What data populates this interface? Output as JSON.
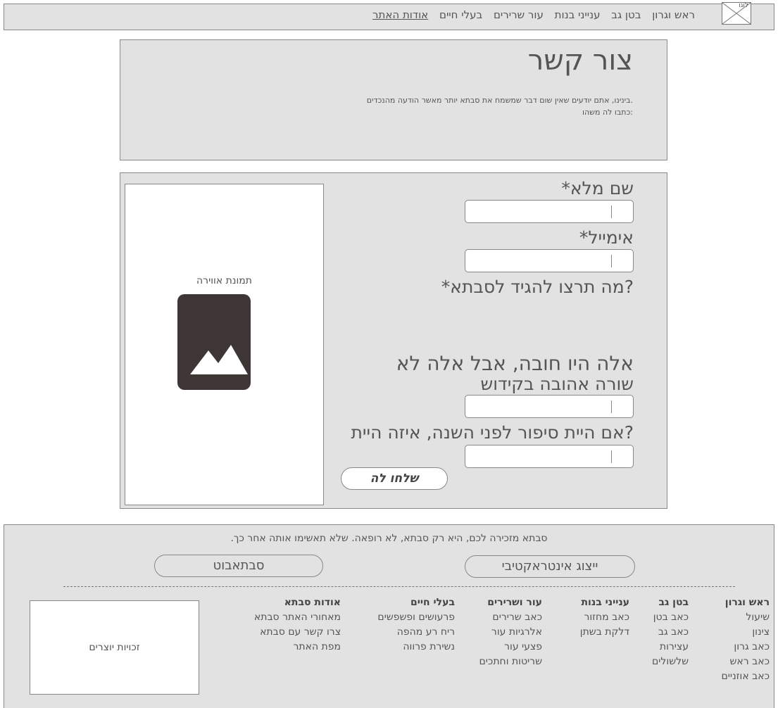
{
  "logo": {
    "text": "לוגו"
  },
  "nav": {
    "items": [
      {
        "label": "ראש וגרון"
      },
      {
        "label": "בטן גב"
      },
      {
        "label": "ענייני בנות"
      },
      {
        "label": "עור שרירים"
      },
      {
        "label": "בעלי חיים"
      },
      {
        "label": "אודות האתר"
      }
    ]
  },
  "header": {
    "title": "צור קשר",
    "intro_line1": ".בינינו, אתם יודעים שאין שום דבר שמשמח את סבתא יותר מאשר הודעה מהנכדים",
    "intro_line2": ":כתבו לה משהו"
  },
  "form": {
    "name_label": "שם מלא*",
    "name_value": "",
    "email_label": "אימייל*",
    "email_value": "",
    "message_label": "?מה תרצו להגיד לסבתא*",
    "optional_heading": "אלה היו חובה, אבל אלה לא",
    "verse_label": "שורה אהובה בקידוש",
    "verse_value": "",
    "story_label": "?אם היית סיפור לפני השנה, איזה היית",
    "story_value": "",
    "send_label": "שלחו לה"
  },
  "image": {
    "caption": "תמונת אווירה",
    "icon": "image-placeholder-icon"
  },
  "footer": {
    "disclaimer": ".סבתא מזכירה לכם, היא רק סבתא, לא רופאה. שלא תאשימו אותה אחר כך",
    "interactive_button": "ייצוג אינטראקטיבי",
    "sabotbot_button": "סבתאבוט",
    "columns": [
      {
        "heading": "ראש וגרון",
        "items": [
          "שיעול",
          "צינון",
          "כאב גרון",
          "כאב ראש",
          "כאב אוזניים"
        ]
      },
      {
        "heading": "בטן גב",
        "items": [
          "כאב בטן",
          "כאב גב",
          "עצירות",
          "שלשולים"
        ]
      },
      {
        "heading": "ענייני בנות",
        "items": [
          "כאב מחזור",
          "דלקת בשתן"
        ]
      },
      {
        "heading": "עור ושרירים",
        "items": [
          "כאב שרירים",
          "אלרגיות עור",
          "פצעי עור",
          "שריטות וחתכים"
        ]
      },
      {
        "heading": "בעלי חיים",
        "items": [
          "פרעושים ופשפשים",
          "ריח רע מהפה",
          "נשירת פרווה"
        ]
      },
      {
        "heading": "אודות סבתא",
        "items": [
          "מאחורי האתר סבתא",
          "צרו קשר עם סבתא",
          "מפת האתר"
        ]
      }
    ],
    "credits": "זכויות יוצרים"
  },
  "colors": {
    "panel": "#e2e2e2",
    "border": "#8a8a8a",
    "icon": "#3e3535"
  }
}
